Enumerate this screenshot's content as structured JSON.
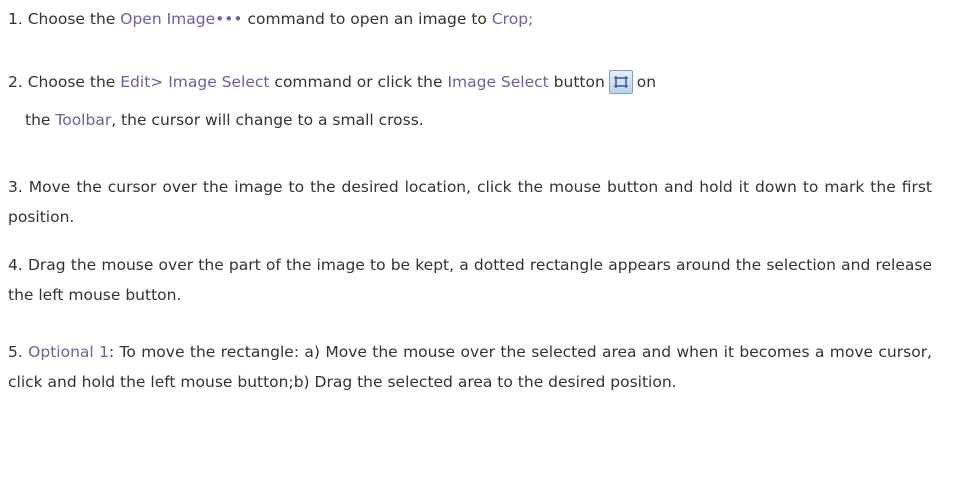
{
  "colors": {
    "text": "#333333",
    "highlight": "#6a5fa8"
  },
  "step1": {
    "num": "1.",
    "t1": "Choose the",
    "link1": "Open Image•••",
    "t2": "command to open an image to",
    "link2": "Crop;"
  },
  "step2": {
    "num": "2.",
    "t1": "Choose the",
    "link1": "Edit> Image Select",
    "t2": "command or click the",
    "link2": "Image Select",
    "t3": "button",
    "icon": "image-select-icon",
    "t4": "on",
    "t5": "the",
    "link3": "Toolbar",
    "t6": ", the cursor will change to a small cross."
  },
  "step3": {
    "num": "3.",
    "t1": "Move the cursor over the image to the desired location, click the mouse button and hold it down to mark the first position."
  },
  "step4": {
    "num": "4.",
    "t1": "Drag the mouse over the part of the image to be kept, a dotted rectangle appears around the selection and release the left mouse button."
  },
  "step5": {
    "num": "5.",
    "link1": "Optional 1",
    "t1": ": To move the rectangle: a) Move the mouse over the selected area and when it becomes a move cursor, click and hold the left mouse button;b) Drag the selected area to the desired position."
  }
}
